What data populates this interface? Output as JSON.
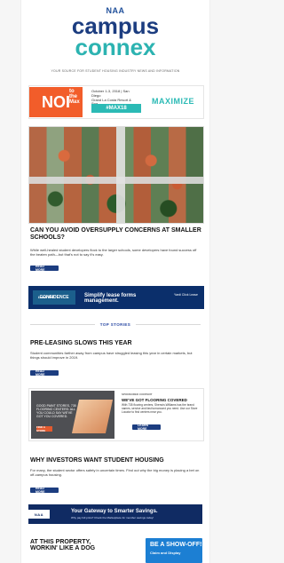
{
  "header": {
    "naa": "NAA",
    "brand_line1": "campus",
    "brand_line2": "connex",
    "tagline": "YOUR SOURCE FOR STUDENT HOUSING INDUSTRY NEWS AND INFORMATION"
  },
  "banner_noi": {
    "noi": "NOI",
    "to_the_max": "to the Max",
    "date_line": "October 1-3, 2018 | San Diego",
    "venue_line": "Grand La Costa Resort & Spa",
    "hashtag": "#MAX18",
    "maximize": "MAXIMIZE"
  },
  "story1": {
    "headline": "CAN YOU AVOID OVERSUPPLY CONCERNS AT SMALLER SCHOOLS?",
    "body": "While well-healed student developers flock to the larger schools, some developers have found success off the beaten path—but that's not to say it's easy.",
    "button": "READ MORE"
  },
  "banner_confidence": {
    "lease_with": "Lease With",
    "confidence": "CONFIDENCE",
    "middle": "Simplify lease forms management.",
    "right": "Yardi Click Lease"
  },
  "section": {
    "label": "TOP STORIES"
  },
  "story2": {
    "headline": "PRE-LEASING SLOWS THIS YEAR",
    "body": "Student communities farther away from campus have struggled leasing this year in certain markets, but things should improve in 2019.",
    "button": "READ MORE"
  },
  "ad_two_up": {
    "image_title": "GOOD PAINT STORES, 735 FLOORING CENTERS: ALL YOU COULD SAY WE'VE GOT YOU COVERED.",
    "image_badge": "FIND A STORE",
    "kicker": "SPONSORED CONTENT",
    "headline": "WE'VE GOT FLOORING COVERED",
    "body": "With 735 flooring centers, Sherwin-Williams has the brand names, service and fast turnaround you need. Use our Store Locator to find centers near you.",
    "button": "LEARN MORE"
  },
  "story3": {
    "headline": "WHY INVESTORS WANT STUDENT HOUSING",
    "body": "For many, the student sector offers safety in uncertain times. Find out why the big money is placing a bet on off-campus housing.",
    "button": "READ MORE"
  },
  "banner_savings": {
    "text": "Your Gateway to Smarter Savings.",
    "sub": "Why pay full price? Check the Marketplace for member savings today!",
    "naa": "NAA"
  },
  "story4": {
    "headline": "AT THIS PROPERTY, WORKIN' LIKE A DOG",
    "showoff_title": "BE A SHOW-OFF!",
    "showoff_sub": "Claim and Display"
  }
}
